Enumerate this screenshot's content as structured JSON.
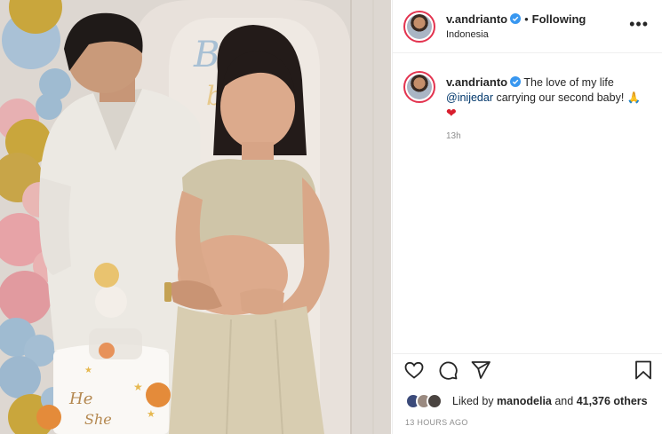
{
  "post": {
    "username": "v.andrianto",
    "follow_status": "Following",
    "separator": "•",
    "location": "Indonesia",
    "more_icon": "more-horizontal-icon"
  },
  "photo": {
    "backdrop_sign": "Boy"
  },
  "caption": {
    "username": "v.andrianto",
    "text_start": "The love of my life",
    "mention": "@inijedar",
    "text_end": "carrying our second baby!",
    "emoji_praying": "🙏",
    "emoji_heart": "❤",
    "time": "13h"
  },
  "actions": {
    "like_icon": "heart-icon",
    "comment_icon": "comment-icon",
    "share_icon": "send-icon",
    "save_icon": "bookmark-icon"
  },
  "likes": {
    "prefix": "Liked by",
    "user": "manodelia",
    "joiner": "and",
    "count": "41,376 others"
  },
  "timestamp": "13 HOURS AGO",
  "colors": {
    "accent_ring": "#e3334f",
    "verified_blue": "#3897f0",
    "mention_blue": "#00376b",
    "muted_gray": "#8e8e8e"
  }
}
